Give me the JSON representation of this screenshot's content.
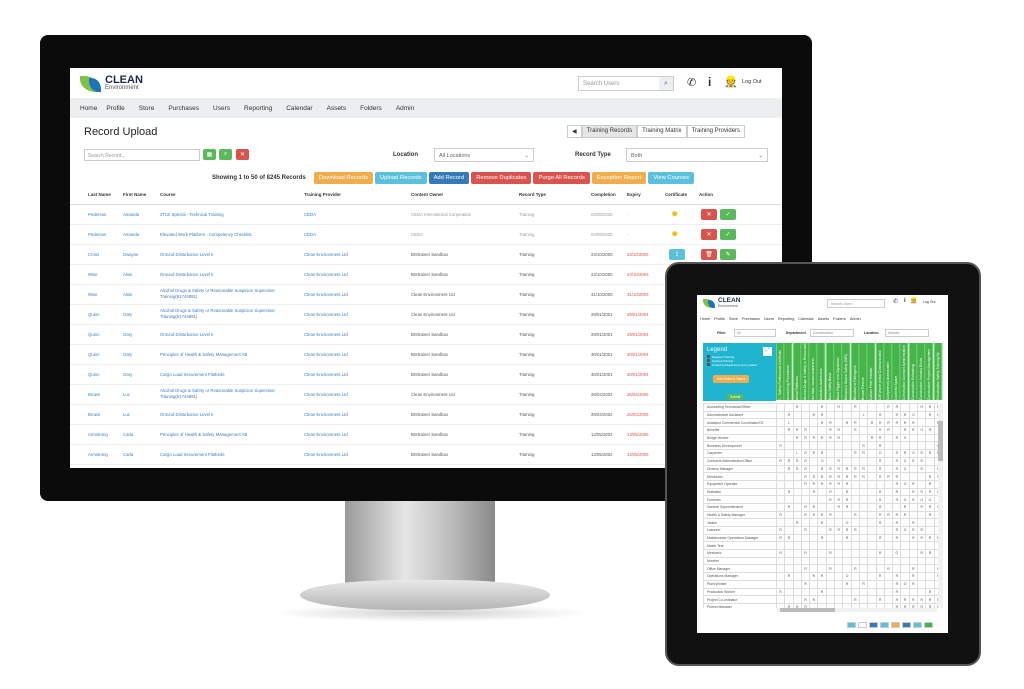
{
  "desktop": {
    "logo": {
      "name": "CLEAN",
      "sub": "Environment"
    },
    "search_users_placeholder": "Search Users",
    "logout": "Log Out",
    "nav": [
      "Home",
      "Profile",
      "Store",
      "Purchases",
      "Users",
      "Reporting",
      "Calendar",
      "Assets",
      "Folders",
      "Admin"
    ],
    "title": "Record Upload",
    "view_tabs": [
      "Training Records",
      "Training Matrix",
      "Training Providers"
    ],
    "search_placeholder": "Search Record...",
    "location_label": "Location",
    "location_value": "All Locations",
    "record_type_label": "Record Type",
    "record_type_value": "Both",
    "showing": "Showing 1 to 50 of 8245 Records",
    "actions": [
      {
        "label": "Download Records",
        "color": "#f0ad4e"
      },
      {
        "label": "Upload Records",
        "color": "#5bc0de"
      },
      {
        "label": "Add Record",
        "color": "#337ab7"
      },
      {
        "label": "Remove Duplicates",
        "color": "#d9534f"
      },
      {
        "label": "Purge All Records",
        "color": "#d9534f"
      },
      {
        "label": "Exception Report",
        "color": "#f0ad4e"
      },
      {
        "label": "View Courses",
        "color": "#5bc0de"
      }
    ],
    "columns": [
      "Last Name",
      "First Name",
      "Course",
      "Training Provider",
      "Content Owner",
      "Record Type",
      "Completion",
      "Expiry",
      "Certificate",
      "Action"
    ],
    "rows": [
      {
        "last": "Pederson",
        "first": "Amanda",
        "course": "3TLE Special - Technical Training",
        "provider": "CEDA",
        "owner": "CEDA International Corporation",
        "type": "Training",
        "completion": "04/08/2020",
        "expiry": "-",
        "cert": "sun-icon",
        "pending": true
      },
      {
        "last": "Pederson",
        "first": "Amanda",
        "course": "Elevated Work Platform - Competency Checklist",
        "provider": "CEDA",
        "owner": "CEDA",
        "type": "Training",
        "completion": "04/09/2020",
        "expiry": "-",
        "cert": "sun-icon",
        "pending": true
      },
      {
        "last": "Cross",
        "first": "Dwayne",
        "course": "Ground Disturbance Level II",
        "provider": "Clean Environment Ltd",
        "owner": "BIStrainer Sandbox",
        "type": "Training",
        "completion": "23/10/2000",
        "expiry": "23/10/2003",
        "cert": "upload-icon"
      },
      {
        "last": "Wise",
        "first": "Alvin",
        "course": "Ground Disturbance Level II",
        "provider": "Clean Environment Ltd",
        "owner": "BIStrainer Sandbox",
        "type": "Training",
        "completion": "23/10/2000",
        "expiry": "23/10/2003",
        "cert": "upload-icon"
      },
      {
        "last": "Wise",
        "first": "Alvin",
        "course": "Alcohol Drugs & Safety or Reasonable Suspicion Supervisor Training(61744891)",
        "provider": "Clean Environment Ltd",
        "owner": "Clean Environment Ltd",
        "type": "Training",
        "completion": "31/10/2000",
        "expiry": "31/10/2003",
        "cert": "upload-icon"
      },
      {
        "last": "Quinn",
        "first": "Gary",
        "course": "Alcohol Drugs & Safety or Reasonable Suspicion Supervisor Training(61744891)",
        "provider": "Clean Environment Ltd",
        "owner": "Clean Environment Ltd",
        "type": "Training",
        "completion": "29/01/2001",
        "expiry": "29/01/2004",
        "cert": "upload-icon"
      },
      {
        "last": "Quinn",
        "first": "Gary",
        "course": "Ground Disturbance Level II",
        "provider": "Clean Environment Ltd",
        "owner": "BIStrainer Sandbox",
        "type": "Training",
        "completion": "29/01/2001",
        "expiry": "29/01/2004",
        "cert": "upload-icon"
      },
      {
        "last": "Quinn",
        "first": "Gary",
        "course": "Principles of Health & Safety Management AB",
        "provider": "Clean Environment Ltd",
        "owner": "BIStrainer Sandbox",
        "type": "Training",
        "completion": "30/01/2001",
        "expiry": "30/01/2004",
        "cert": "upload-icon"
      },
      {
        "last": "Quinn",
        "first": "Gary",
        "course": "Cargo Load Securement Flatbeds",
        "provider": "Clean Environment Ltd",
        "owner": "BIStrainer Sandbox",
        "type": "Training",
        "completion": "30/01/2001",
        "expiry": "30/01/2004",
        "cert": "upload-icon"
      },
      {
        "last": "Brown",
        "first": "Luz",
        "course": "Alcohol Drugs & Safety or Reasonable Suspicion Supervisor Training(61744891)",
        "provider": "Clean Environment Ltd",
        "owner": "Clean Environment Ltd",
        "type": "Training",
        "completion": "26/04/2002",
        "expiry": "26/04/2005",
        "cert": "upload-icon"
      },
      {
        "last": "Brown",
        "first": "Luz",
        "course": "Ground Disturbance Level II",
        "provider": "Clean Environment Ltd",
        "owner": "BIStrainer Sandbox",
        "type": "Training",
        "completion": "26/04/2002",
        "expiry": "26/04/2005",
        "cert": "upload-icon"
      },
      {
        "last": "Armstrong",
        "first": "Carla",
        "course": "Principles of Health & Safety Management AB",
        "provider": "Clean Environment Ltd",
        "owner": "BIStrainer Sandbox",
        "type": "Training",
        "completion": "13/05/2002",
        "expiry": "13/05/2005",
        "cert": "upload-icon"
      },
      {
        "last": "Armstrong",
        "first": "Carla",
        "course": "Cargo Load Securement Flatbeds",
        "provider": "Clean Environment Ltd",
        "owner": "BIStrainer Sandbox",
        "type": "Training",
        "completion": "13/05/2002",
        "expiry": "13/05/2005",
        "cert": "upload-icon"
      }
    ]
  },
  "tablet": {
    "logo": {
      "name": "CLEAN",
      "sub": "Environment"
    },
    "search_users_placeholder": "Search Users",
    "logout": "Log Out",
    "nav": [
      "Home",
      "Profile",
      "Store",
      "Purchases",
      "Users",
      "Reporting",
      "Calendar",
      "Assets",
      "Folders",
      "Admin"
    ],
    "filter_label": "Filter",
    "filter_value": "All",
    "department_label": "Department",
    "department_value": "Construction",
    "location_label": "Location",
    "location_value": "Alberta",
    "legend": {
      "title": "Legend",
      "items": [
        "Required Training",
        "Optional Training",
        "Limited by Department and Location"
      ],
      "edit_button": "Edit Roles & Topics",
      "submit_button": "Submit",
      "color": "#1fb5d0"
    },
    "header_color": "#44b549",
    "topics": [
      "1 - Safety Professional Certificate",
      "Accounting Procedures",
      "Aerial Platforms",
      "Alcohol Drugs & Safety or Reasonable",
      "Arc flash hazard awareness",
      "Asbestos Awareness",
      "Back Safety Basic",
      "Basic Rigger and Signalman",
      "Behaviour Based Safety (BBS)",
      "Bloodborne Pathogens",
      "Bucket Rescue",
      "Carbon Fiber Installer",
      "Cell phone policy Communication",
      "Competency Assessment",
      "Confined Space",
      "Construction Contract Administration",
      "Construction Estimating",
      "Construction Industry Ethics",
      "Construction Project Management",
      "Construction Safety Training Sy"
    ],
    "matrix": [
      {
        "role": "Accounting Technician/Office",
        "cells": "--R--R-R-R---RR--RRR"
      },
      {
        "role": "Administrative Assistant",
        "cells": "-R--RR----L-R-RRO-RR"
      },
      {
        "role": "Assistant Commercial Coordinator/Of",
        "cells": "-L---RR-RR-RRRRRR--R"
      },
      {
        "role": "Benefits",
        "cells": "-RRR--RR-R--RR-RROR-"
      },
      {
        "role": "Bridge Worker",
        "cells": "--RRRRRR---RR-RO----"
      },
      {
        "role": "Business Development",
        "cells": "R---------R-R------R"
      },
      {
        "role": "Carpenter",
        "cells": "--LRRR---RR-O-RRORRR"
      },
      {
        "role": "Contracts Administrator/Office",
        "cells": "RRRR-O-R----R-RORR--"
      },
      {
        "role": "Division Manager",
        "cells": "-RRR-RRRRRR-R-RO-R-R"
      },
      {
        "role": "Electrician",
        "cells": "---RRRRRRRR-RRR---RR"
      },
      {
        "role": "Equipment Operator",
        "cells": "---RRRRRR-----ROR-R-"
      },
      {
        "role": "Estimator",
        "cells": "-R--R-R-R---R-R-RRRR"
      },
      {
        "role": "Foreman",
        "cells": "------RRR---R-ROROO-"
      },
      {
        "role": "General Superintendent",
        "cells": "-R-RR--RR---R--R-RRR"
      },
      {
        "role": "Health & Safety Manager",
        "cells": "R--RRRR--R--RRRR--R-"
      },
      {
        "role": "Janitor",
        "cells": "--R--R--O---R-R-R---"
      },
      {
        "role": "Labourer",
        "cells": "R--R--RRRR----RORR--"
      },
      {
        "role": "Maintenance Operations Manager",
        "cells": "RR---R--R---R-R-RRRR"
      },
      {
        "role": "Matrix Test",
        "cells": "--------------------"
      },
      {
        "role": "Mechanic",
        "cells": "R--R--R-----R-O--RR-"
      },
      {
        "role": "Number",
        "cells": "--------------------"
      },
      {
        "role": "Office Manager",
        "cells": "---R--R--R---R--R--R"
      },
      {
        "role": "Operations Manager",
        "cells": "-R--RR--O---R-R-R--R"
      },
      {
        "role": "Plant Worker",
        "cells": "---R----R-R---ROR---"
      },
      {
        "role": "Production Worker",
        "cells": "R----R--------R---R-"
      },
      {
        "role": "Project Co-ordinator",
        "cells": "---RR----R--R-RRRRRR"
      },
      {
        "role": "Project Manager",
        "cells": "-RRR----------RRRRRR"
      }
    ],
    "pager_colors": [
      "#5bc0de",
      "#ffffff",
      "#337ab7",
      "#5bc0de",
      "#f0ad4e",
      "#337ab7",
      "#5bc0de",
      "#44b549"
    ]
  }
}
